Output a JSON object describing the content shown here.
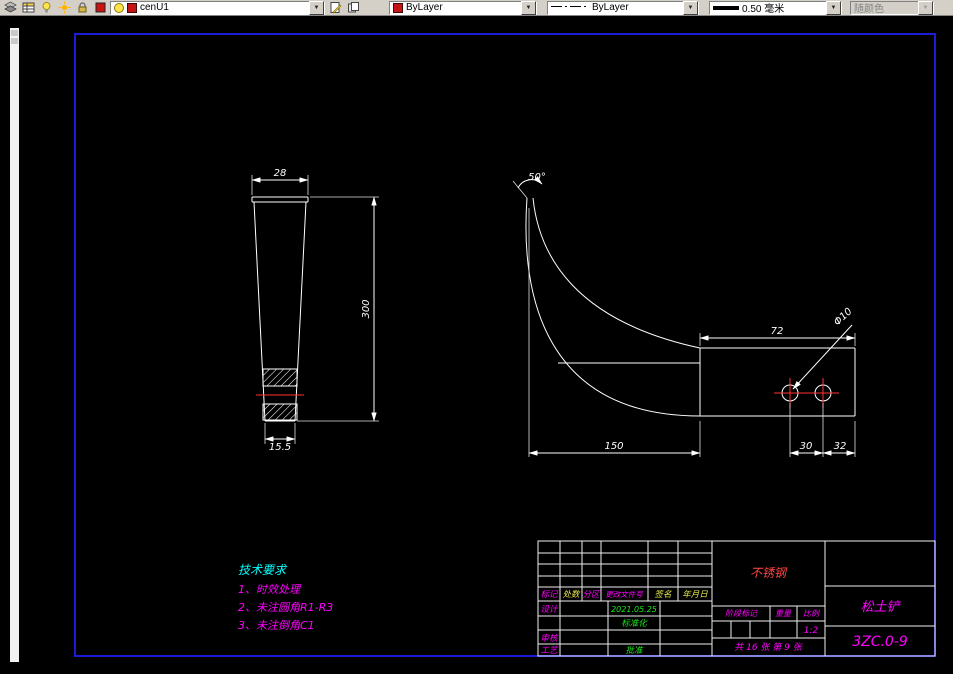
{
  "colors": {
    "magenta": "#ff00ff",
    "green": "#1ae61a",
    "yellow": "#e6e650",
    "red": "#ff4545",
    "cyan": "#00ffff",
    "frame_blue": "#1b1bd8",
    "centerline_red": "#ff3232",
    "dim_white": "#ffffff"
  },
  "icons": {
    "dropdown_arrow": "▼"
  },
  "toolbar": {
    "layer_combo_value": "cenU1",
    "color_combo_value": "ByLayer",
    "linetype_combo_value": "ByLayer",
    "lineweight_combo_value": "0.50 毫米",
    "plot_style_value": "随颜色"
  },
  "drawing": {
    "front_view": {
      "dim_width_top": "28",
      "dim_height": "300",
      "dim_width_bottom": "15.5"
    },
    "side_view": {
      "dim_angle": "50°",
      "dim_plate_length": "72",
      "dim_hole_callout": "Φ10",
      "dim_overall_length": "150",
      "dim_hole_spacing": "30",
      "dim_hole_to_edge": "32"
    },
    "tech_requirements": {
      "title": "技术要求",
      "items": [
        "1、时效处理",
        "2、未注圆角R1-R3",
        "3、未注倒角C1"
      ]
    },
    "title_block": {
      "material": "不锈钢",
      "part_name": "松土铲",
      "drawing_number": "3ZC.0-9",
      "columns": {
        "mark": "标记",
        "count": "处数",
        "zone": "分区",
        "file_no": "更改文件号",
        "signature": "签名",
        "date": "年月日"
      },
      "rows": {
        "design": "设计",
        "standardization": "标准化",
        "check": "审核",
        "process": "工艺",
        "approve": "批准"
      },
      "design_date": "2021.05.25",
      "stage_mark": "阶段标记",
      "weight": "重量",
      "scale": "比例",
      "scale_value": "1:2",
      "sheet_info": "共 16 张 第 9 张"
    }
  }
}
